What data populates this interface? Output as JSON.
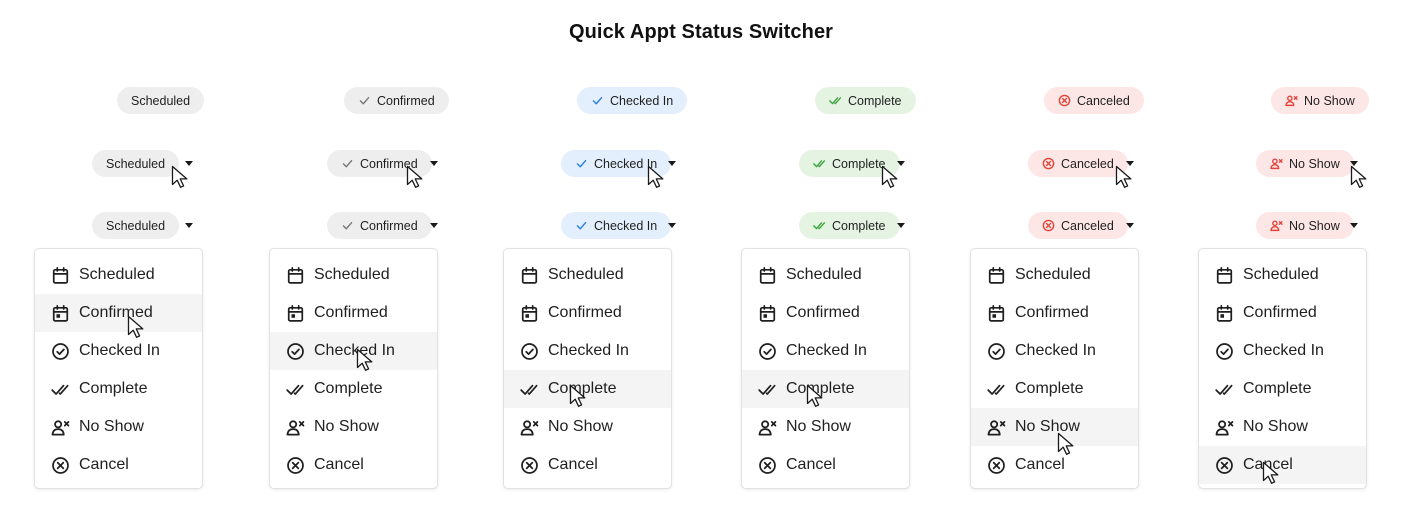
{
  "title": "Quick Appt Status Switcher",
  "colors": {
    "neutral_bg": "#eeeeee",
    "blue_bg": "#e3effd",
    "blue_icon": "#2a7de1",
    "green_bg": "#e5f4e2",
    "green_icon": "#3ba33b",
    "red_bg": "#fde6e6",
    "red_icon": "#e0453a",
    "gray_icon": "#777777",
    "hover_row": "#f4f4f4"
  },
  "menu_items": [
    {
      "label": "Scheduled",
      "icon": "calendar-icon"
    },
    {
      "label": "Confirmed",
      "icon": "calendar-check-icon"
    },
    {
      "label": "Checked In",
      "icon": "check-circle-icon"
    },
    {
      "label": "Complete",
      "icon": "double-check-icon"
    },
    {
      "label": "No Show",
      "icon": "user-x-icon"
    },
    {
      "label": "Cancel",
      "icon": "x-circle-icon"
    }
  ],
  "columns": [
    {
      "status": "Scheduled",
      "icon": "none",
      "tone": "neutral",
      "hovered_menu_item": "Confirmed"
    },
    {
      "status": "Confirmed",
      "icon": "check-icon",
      "tone": "neutral",
      "hovered_menu_item": "Checked In"
    },
    {
      "status": "Checked In",
      "icon": "check-icon",
      "tone": "blue",
      "hovered_menu_item": "Complete"
    },
    {
      "status": "Complete",
      "icon": "double-check-icon",
      "tone": "green",
      "hovered_menu_item": "Complete"
    },
    {
      "status": "Canceled",
      "icon": "x-circle-icon",
      "tone": "red",
      "hovered_menu_item": "No Show"
    },
    {
      "status": "No Show",
      "icon": "user-x-icon",
      "tone": "red",
      "hovered_menu_item": "Cancel"
    }
  ]
}
